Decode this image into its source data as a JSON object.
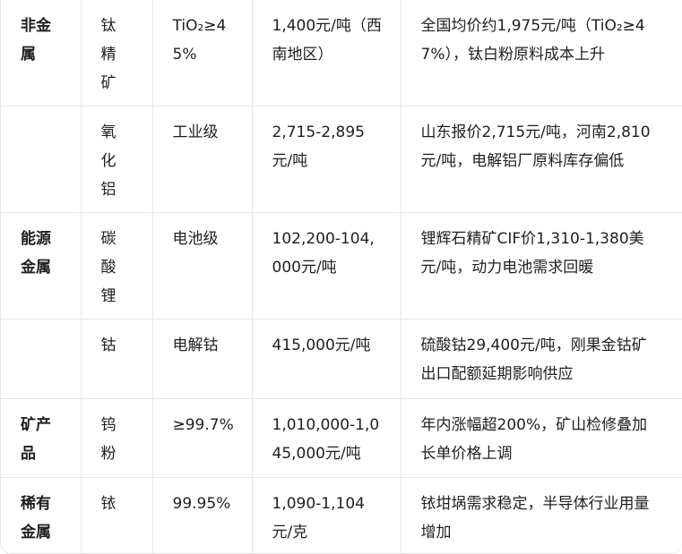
{
  "rows": [
    {
      "category": "非金属",
      "product": "钛精矿",
      "spec": "TiO₂≥45%",
      "price": "1,400元/吨（西南地区）",
      "note": "全国均价约1,975元/吨（TiO₂≥47%），钛白粉原料成本上升"
    },
    {
      "category": "",
      "product": "氧化铝",
      "spec": "工业级",
      "price": "2,715-2,895元/吨",
      "note": "山东报价2,715元/吨，河南2,810元/吨，电解铝厂原料库存偏低"
    },
    {
      "category": "能源金属",
      "product": "碳酸锂",
      "spec": "电池级",
      "price": "102,200-104,000元/吨",
      "note": "锂辉石精矿CIF价1,310-1,380美元/吨，动力电池需求回暖"
    },
    {
      "category": "",
      "product": "钴",
      "spec": "电解钴",
      "price": "415,000元/吨",
      "note": "硫酸钴29,400元/吨，刚果金钴矿出口配额延期影响供应"
    },
    {
      "category": "矿产品",
      "product": "钨粉",
      "spec": "≥99.7%",
      "price": "1,010,000-1,045,000元/吨",
      "note": "年内涨幅超200%，矿山检修叠加长单价格上调"
    },
    {
      "category": "稀有金属",
      "product": "铱",
      "spec": "99.95%",
      "price": "1,090-1,104元/克",
      "note": "铱坩埚需求稳定，半导体行业用量增加"
    }
  ]
}
